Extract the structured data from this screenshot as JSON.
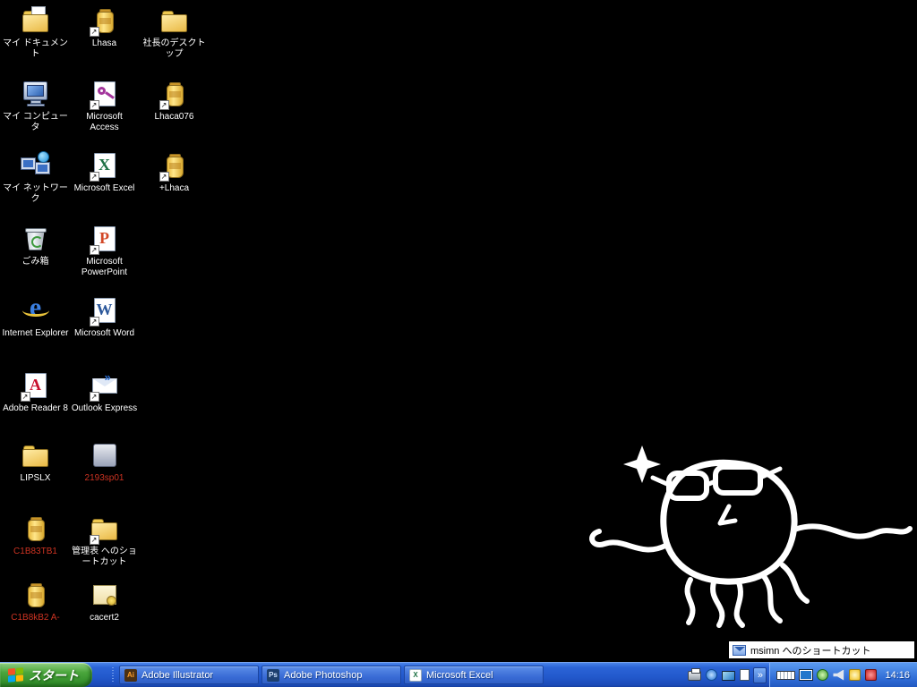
{
  "desktop": {
    "background_color": "#000000",
    "doodle": {
      "name": "octopus-with-sunglasses-doodle"
    },
    "icons": [
      {
        "id": "my-documents",
        "label": "マイ ドキュメント",
        "type": "folder-doc",
        "col": 0,
        "row": 0
      },
      {
        "id": "lhasa",
        "label": "Lhasa",
        "type": "jar",
        "col": 1,
        "row": 0,
        "shortcut": true
      },
      {
        "id": "president-desktop",
        "label": "社長のデスクトップ",
        "type": "folder",
        "col": 2,
        "row": 0
      },
      {
        "id": "my-computer",
        "label": "マイ コンピュータ",
        "type": "computer",
        "col": 0,
        "row": 1
      },
      {
        "id": "ms-access",
        "label": "Microsoft Access",
        "type": "access",
        "col": 1,
        "row": 1,
        "shortcut": true
      },
      {
        "id": "lhaca076",
        "label": "Lhaca076",
        "type": "jar",
        "col": 2,
        "row": 1,
        "shortcut": true
      },
      {
        "id": "my-network",
        "label": "マイ ネットワーク",
        "type": "network",
        "col": 0,
        "row": 2
      },
      {
        "id": "ms-excel",
        "label": "Microsoft Excel",
        "type": "excel",
        "col": 1,
        "row": 2,
        "shortcut": true
      },
      {
        "id": "plus-lhaca",
        "label": "+Lhaca",
        "type": "jar",
        "col": 2,
        "row": 2,
        "shortcut": true
      },
      {
        "id": "recycle-bin",
        "label": "ごみ箱",
        "type": "recycle",
        "col": 0,
        "row": 3
      },
      {
        "id": "ms-powerpoint",
        "label": "Microsoft PowerPoint",
        "type": "powerpoint",
        "col": 1,
        "row": 3,
        "shortcut": true
      },
      {
        "id": "internet-explorer",
        "label": "Internet Explorer",
        "type": "ie",
        "col": 0,
        "row": 4
      },
      {
        "id": "ms-word",
        "label": "Microsoft Word",
        "type": "word",
        "col": 1,
        "row": 4,
        "shortcut": true
      },
      {
        "id": "adobe-reader-8",
        "label": "Adobe Reader 8",
        "type": "reader",
        "col": 0,
        "row": 5,
        "shortcut": true
      },
      {
        "id": "outlook-express",
        "label": "Outlook Express",
        "type": "outlook",
        "col": 1,
        "row": 5,
        "shortcut": true
      },
      {
        "id": "lipslx",
        "label": "LIPSLX",
        "type": "folder",
        "col": 0,
        "row": 6
      },
      {
        "id": "app-2193",
        "label": "2193sp01",
        "type": "app-gray",
        "col": 1,
        "row": 6,
        "label_color": "#cc3322"
      },
      {
        "id": "archive-c1a",
        "label": "C1B83TB1",
        "type": "jar",
        "col": 0,
        "row": 7,
        "label_color": "#cc3322"
      },
      {
        "id": "kanri-folder",
        "label": "管理表 へのショートカット",
        "type": "folder",
        "col": 1,
        "row": 7,
        "shortcut": true
      },
      {
        "id": "archive-c1b",
        "label": "C1B8kB2 A-",
        "type": "jar",
        "col": 0,
        "row": 8,
        "label_color": "#cc3322"
      },
      {
        "id": "cacert2",
        "label": "cacert2",
        "type": "cert",
        "col": 1,
        "row": 8
      }
    ]
  },
  "rename_box": {
    "icon": "msimn-outlook-express-icon",
    "text": "msimn へのショートカット"
  },
  "taskbar": {
    "start_label": "スタート",
    "tasks": [
      {
        "id": "illustrator",
        "label": "Adobe Illustrator"
      },
      {
        "id": "photoshop",
        "label": "Adobe Photoshop"
      },
      {
        "id": "excel",
        "label": "Microsoft Excel"
      }
    ],
    "overflow_chevron": "»",
    "tray_left": [
      "printer-icon",
      "update-icon",
      "display-icon",
      "document-icon"
    ],
    "tray_right": [
      "keyboard-icon",
      "network-icon",
      "messenger-icon",
      "volume-icon",
      "scheduler-icon",
      "antivirus-icon"
    ],
    "clock": "14:16"
  }
}
